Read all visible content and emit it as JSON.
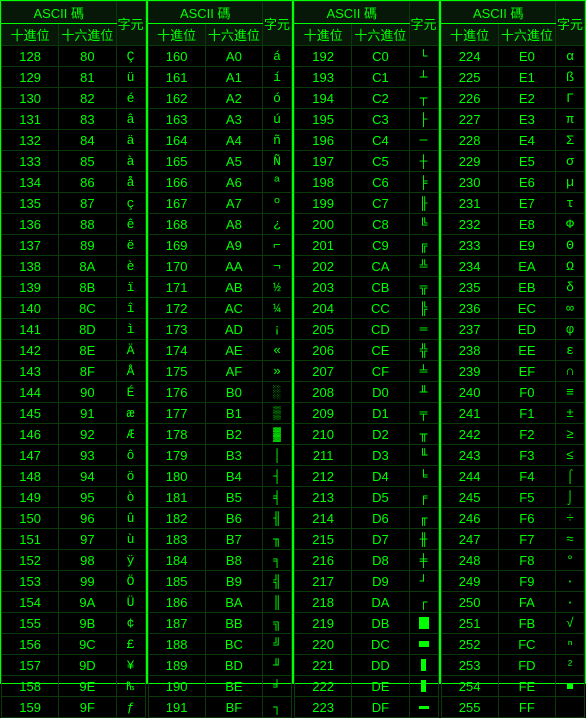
{
  "hdr": {
    "main": "ASCII 碼",
    "dec": "十進位",
    "hex": "十六進位",
    "ch": "字元"
  },
  "cols": [
    [
      {
        "d": "128",
        "h": "80",
        "c": "Ç"
      },
      {
        "d": "129",
        "h": "81",
        "c": "ü"
      },
      {
        "d": "130",
        "h": "82",
        "c": "é"
      },
      {
        "d": "131",
        "h": "83",
        "c": "â"
      },
      {
        "d": "132",
        "h": "84",
        "c": "ä"
      },
      {
        "d": "133",
        "h": "85",
        "c": "à"
      },
      {
        "d": "134",
        "h": "86",
        "c": "å"
      },
      {
        "d": "135",
        "h": "87",
        "c": "ç"
      },
      {
        "d": "136",
        "h": "88",
        "c": "ê"
      },
      {
        "d": "137",
        "h": "89",
        "c": "ë"
      },
      {
        "d": "138",
        "h": "8A",
        "c": "è"
      },
      {
        "d": "139",
        "h": "8B",
        "c": "ï"
      },
      {
        "d": "140",
        "h": "8C",
        "c": "î"
      },
      {
        "d": "141",
        "h": "8D",
        "c": "ì"
      },
      {
        "d": "142",
        "h": "8E",
        "c": "Ä"
      },
      {
        "d": "143",
        "h": "8F",
        "c": "Å"
      },
      {
        "d": "144",
        "h": "90",
        "c": "É"
      },
      {
        "d": "145",
        "h": "91",
        "c": "æ"
      },
      {
        "d": "146",
        "h": "92",
        "c": "Æ"
      },
      {
        "d": "147",
        "h": "93",
        "c": "ô"
      },
      {
        "d": "148",
        "h": "94",
        "c": "ö"
      },
      {
        "d": "149",
        "h": "95",
        "c": "ò"
      },
      {
        "d": "150",
        "h": "96",
        "c": "û"
      },
      {
        "d": "151",
        "h": "97",
        "c": "ù"
      },
      {
        "d": "152",
        "h": "98",
        "c": "ÿ"
      },
      {
        "d": "153",
        "h": "99",
        "c": "Ö"
      },
      {
        "d": "154",
        "h": "9A",
        "c": "Ü"
      },
      {
        "d": "155",
        "h": "9B",
        "c": "¢"
      },
      {
        "d": "156",
        "h": "9C",
        "c": "£"
      },
      {
        "d": "157",
        "h": "9D",
        "c": "¥"
      },
      {
        "d": "158",
        "h": "9E",
        "c": "₧"
      },
      {
        "d": "159",
        "h": "9F",
        "c": "ƒ"
      }
    ],
    [
      {
        "d": "160",
        "h": "A0",
        "c": "á"
      },
      {
        "d": "161",
        "h": "A1",
        "c": "í"
      },
      {
        "d": "162",
        "h": "A2",
        "c": "ó"
      },
      {
        "d": "163",
        "h": "A3",
        "c": "ú"
      },
      {
        "d": "164",
        "h": "A4",
        "c": "ñ"
      },
      {
        "d": "165",
        "h": "A5",
        "c": "Ñ"
      },
      {
        "d": "166",
        "h": "A6",
        "c": "ª"
      },
      {
        "d": "167",
        "h": "A7",
        "c": "º"
      },
      {
        "d": "168",
        "h": "A8",
        "c": "¿"
      },
      {
        "d": "169",
        "h": "A9",
        "c": "⌐"
      },
      {
        "d": "170",
        "h": "AA",
        "c": "¬"
      },
      {
        "d": "171",
        "h": "AB",
        "c": "½"
      },
      {
        "d": "172",
        "h": "AC",
        "c": "¼"
      },
      {
        "d": "173",
        "h": "AD",
        "c": "¡"
      },
      {
        "d": "174",
        "h": "AE",
        "c": "«"
      },
      {
        "d": "175",
        "h": "AF",
        "c": "»"
      },
      {
        "d": "176",
        "h": "B0",
        "c": "░"
      },
      {
        "d": "177",
        "h": "B1",
        "c": "▒"
      },
      {
        "d": "178",
        "h": "B2",
        "c": "▓"
      },
      {
        "d": "179",
        "h": "B3",
        "c": "│"
      },
      {
        "d": "180",
        "h": "B4",
        "c": "┤"
      },
      {
        "d": "181",
        "h": "B5",
        "c": "╡"
      },
      {
        "d": "182",
        "h": "B6",
        "c": "╢"
      },
      {
        "d": "183",
        "h": "B7",
        "c": "╖"
      },
      {
        "d": "184",
        "h": "B8",
        "c": "╕"
      },
      {
        "d": "185",
        "h": "B9",
        "c": "╣"
      },
      {
        "d": "186",
        "h": "BA",
        "c": "║"
      },
      {
        "d": "187",
        "h": "BB",
        "c": "╗"
      },
      {
        "d": "188",
        "h": "BC",
        "c": "╝"
      },
      {
        "d": "189",
        "h": "BD",
        "c": "╜"
      },
      {
        "d": "190",
        "h": "BE",
        "c": "╛"
      },
      {
        "d": "191",
        "h": "BF",
        "c": "┐"
      }
    ],
    [
      {
        "d": "192",
        "h": "C0",
        "c": "└"
      },
      {
        "d": "193",
        "h": "C1",
        "c": "┴"
      },
      {
        "d": "194",
        "h": "C2",
        "c": "┬"
      },
      {
        "d": "195",
        "h": "C3",
        "c": "├"
      },
      {
        "d": "196",
        "h": "C4",
        "c": "─"
      },
      {
        "d": "197",
        "h": "C5",
        "c": "┼"
      },
      {
        "d": "198",
        "h": "C6",
        "c": "╞"
      },
      {
        "d": "199",
        "h": "C7",
        "c": "╟"
      },
      {
        "d": "200",
        "h": "C8",
        "c": "╚"
      },
      {
        "d": "201",
        "h": "C9",
        "c": "╔"
      },
      {
        "d": "202",
        "h": "CA",
        "c": "╩"
      },
      {
        "d": "203",
        "h": "CB",
        "c": "╦"
      },
      {
        "d": "204",
        "h": "CC",
        "c": "╠"
      },
      {
        "d": "205",
        "h": "CD",
        "c": "═"
      },
      {
        "d": "206",
        "h": "CE",
        "c": "╬"
      },
      {
        "d": "207",
        "h": "CF",
        "c": "╧"
      },
      {
        "d": "208",
        "h": "D0",
        "c": "╨"
      },
      {
        "d": "209",
        "h": "D1",
        "c": "╤"
      },
      {
        "d": "210",
        "h": "D2",
        "c": "╥"
      },
      {
        "d": "211",
        "h": "D3",
        "c": "╙"
      },
      {
        "d": "212",
        "h": "D4",
        "c": "╘"
      },
      {
        "d": "213",
        "h": "D5",
        "c": "╒"
      },
      {
        "d": "214",
        "h": "D6",
        "c": "╓"
      },
      {
        "d": "215",
        "h": "D7",
        "c": "╫"
      },
      {
        "d": "216",
        "h": "D8",
        "c": "╪"
      },
      {
        "d": "217",
        "h": "D9",
        "c": "┘"
      },
      {
        "d": "218",
        "h": "DA",
        "c": "┌"
      },
      {
        "d": "219",
        "h": "DB",
        "c": "█",
        "g": "block"
      },
      {
        "d": "220",
        "h": "DC",
        "c": "▄",
        "g": "hblock"
      },
      {
        "d": "221",
        "h": "DD",
        "c": "▌",
        "g": "vblock"
      },
      {
        "d": "222",
        "h": "DE",
        "c": "▐",
        "g": "vblock"
      },
      {
        "d": "223",
        "h": "DF",
        "c": "▀",
        "g": "tblock"
      }
    ],
    [
      {
        "d": "224",
        "h": "E0",
        "c": "α"
      },
      {
        "d": "225",
        "h": "E1",
        "c": "ß"
      },
      {
        "d": "226",
        "h": "E2",
        "c": "Γ"
      },
      {
        "d": "227",
        "h": "E3",
        "c": "π"
      },
      {
        "d": "228",
        "h": "E4",
        "c": "Σ"
      },
      {
        "d": "229",
        "h": "E5",
        "c": "σ"
      },
      {
        "d": "230",
        "h": "E6",
        "c": "µ"
      },
      {
        "d": "231",
        "h": "E7",
        "c": "τ"
      },
      {
        "d": "232",
        "h": "E8",
        "c": "Φ"
      },
      {
        "d": "233",
        "h": "E9",
        "c": "Θ"
      },
      {
        "d": "234",
        "h": "EA",
        "c": "Ω"
      },
      {
        "d": "235",
        "h": "EB",
        "c": "δ"
      },
      {
        "d": "236",
        "h": "EC",
        "c": "∞"
      },
      {
        "d": "237",
        "h": "ED",
        "c": "φ"
      },
      {
        "d": "238",
        "h": "EE",
        "c": "ε"
      },
      {
        "d": "239",
        "h": "EF",
        "c": "∩"
      },
      {
        "d": "240",
        "h": "F0",
        "c": "≡"
      },
      {
        "d": "241",
        "h": "F1",
        "c": "±"
      },
      {
        "d": "242",
        "h": "F2",
        "c": "≥"
      },
      {
        "d": "243",
        "h": "F3",
        "c": "≤"
      },
      {
        "d": "244",
        "h": "F4",
        "c": "⌠"
      },
      {
        "d": "245",
        "h": "F5",
        "c": "⌡"
      },
      {
        "d": "246",
        "h": "F6",
        "c": "÷"
      },
      {
        "d": "247",
        "h": "F7",
        "c": "≈"
      },
      {
        "d": "248",
        "h": "F8",
        "c": "°"
      },
      {
        "d": "249",
        "h": "F9",
        "c": "∙"
      },
      {
        "d": "250",
        "h": "FA",
        "c": "·"
      },
      {
        "d": "251",
        "h": "FB",
        "c": "√"
      },
      {
        "d": "252",
        "h": "FC",
        "c": "ⁿ"
      },
      {
        "d": "253",
        "h": "FD",
        "c": "²"
      },
      {
        "d": "254",
        "h": "FE",
        "c": "■",
        "g": "sblock"
      },
      {
        "d": "255",
        "h": "FF",
        "c": " "
      }
    ]
  ]
}
